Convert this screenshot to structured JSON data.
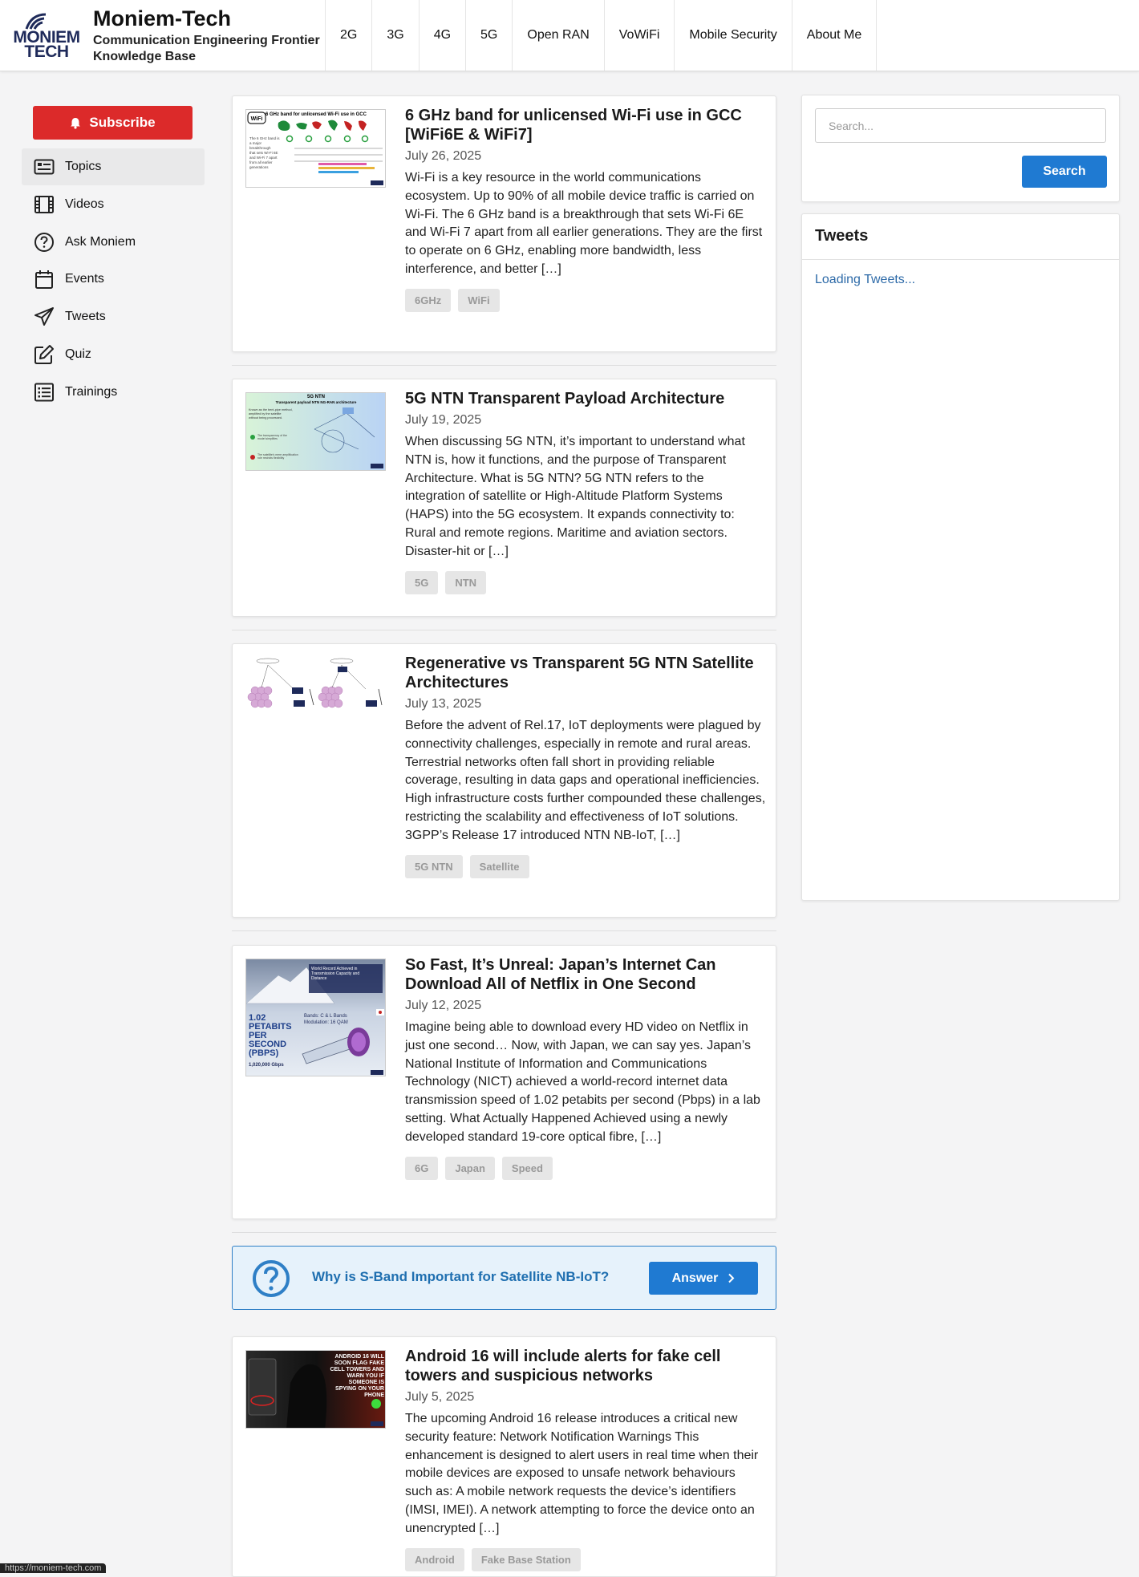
{
  "header": {
    "logo_line1": "MONIEM",
    "logo_line2": "TECH",
    "site_name": "Moniem-Tech",
    "tagline_line1": "Communication Engineering Frontier",
    "tagline_line2": "Knowledge Base",
    "nav": [
      "2G",
      "3G",
      "4G",
      "5G",
      "Open RAN",
      "VoWiFi",
      "Mobile Security",
      "About Me"
    ]
  },
  "sidebar": {
    "subscribe_label": "Subscribe",
    "items": [
      {
        "label": "Topics",
        "icon": "list-box-icon",
        "active": true
      },
      {
        "label": "Videos",
        "icon": "film-icon",
        "active": false
      },
      {
        "label": "Ask Moniem",
        "icon": "question-circle-icon",
        "active": false
      },
      {
        "label": "Events",
        "icon": "calendar-icon",
        "active": false
      },
      {
        "label": "Tweets",
        "icon": "paper-plane-icon",
        "active": false
      },
      {
        "label": "Quiz",
        "icon": "edit-icon",
        "active": false
      },
      {
        "label": "Trainings",
        "icon": "list-icon",
        "active": false
      }
    ]
  },
  "posts": [
    {
      "title": "6 GHz band for unlicensed Wi-Fi use in GCC [WiFi6E & WiFi7]",
      "date": "July 26, 2025",
      "excerpt": "Wi-Fi is a key resource in the world communications ecosystem. Up to 90% of all mobile device traffic is carried on Wi-Fi. The 6 GHz band is a breakthrough that sets Wi-Fi 6E and Wi-Fi 7 apart from all earlier generations. They are the first to operate on 6 GHz, enabling more bandwidth, less interference, and better […]",
      "tags": [
        "6GHz",
        "WiFi"
      ]
    },
    {
      "title": "5G NTN Transparent Payload Architecture",
      "date": "July 19, 2025",
      "excerpt": "When discussing 5G NTN, it’s important to understand what NTN is, how it functions, and the purpose of Transparent Architecture. What is 5G NTN? 5G NTN refers to the integration of satellite or High-Altitude Platform Systems (HAPS) into the 5G ecosystem. It expands connectivity to: Rural and remote regions. Maritime and aviation sectors. Disaster-hit or […]",
      "tags": [
        "5G",
        "NTN"
      ]
    },
    {
      "title": "Regenerative vs Transparent 5G NTN Satellite Architectures",
      "date": "July 13, 2025",
      "excerpt": "Before the advent of Rel.17, IoT deployments were plagued by connectivity challenges, especially in remote and rural areas. Terrestrial networks often fall short in providing reliable coverage, resulting in data gaps and operational inefficiencies. High infrastructure costs further compounded these challenges, restricting the scalability and effectiveness of IoT solutions. 3GPP’s Release 17 introduced NTN NB-IoT, […]",
      "tags": [
        "5G NTN",
        "Satellite"
      ]
    },
    {
      "title": "So Fast, It’s Unreal: Japan’s Internet Can Download All of Netflix in One Second",
      "date": "July 12, 2025",
      "excerpt": "Imagine being able to download every HD video on Netflix in just one second… Now, with Japan, we can say yes. Japan’s National Institute of Information and Communications Technology (NICT) achieved a world-record internet data transmission speed of 1.02 petabits per second (Pbps) in a lab setting. What Actually Happened Achieved using a newly developed standard 19-core optical fibre, […]",
      "tags": [
        "6G",
        "Japan",
        "Speed"
      ]
    },
    {
      "title": "Android 16 will include alerts for fake cell towers and suspicious networks",
      "date": "July 5, 2025",
      "excerpt": "The upcoming Android 16 release introduces a critical new security feature: Network Notification Warnings This enhancement is designed to alert users in real time when their mobile devices are exposed to unsafe network behaviours such as: A mobile network requests the device’s identifiers (IMSI, IMEI). A network attempting to force the device onto an unencrypted […]",
      "tags": [
        "Android",
        "Fake Base Station"
      ]
    }
  ],
  "thumbs": {
    "t1": {
      "title": "6 GHz band for unlicensed Wi-Fi use in GCC",
      "badge": "WiFi",
      "side": "The 6 GHz band is a major breakthrough that sets Wi-Fi 6E and Wi-Fi 7 apart from all earlier generations"
    },
    "t2": {
      "title": "5G NTN",
      "subtitle": "Transparent payload NTN NG-RAN architecture"
    },
    "t4": {
      "big": "1.02 PETABITS PER SECOND (PBPS)",
      "small": "1,020,000 Gbps",
      "bands": "Bands: C & L Bands",
      "mod": "Modulation: 16 QAM",
      "box": "World Record Achieved in Transmission Capacity and Distance"
    },
    "t5": {
      "line1": "ANDROID 16 WILL",
      "line2": "SOON FLAG FAKE",
      "line3": "CELL TOWERS AND",
      "line4": "WARN YOU IF",
      "line5": "SOMEONE IS",
      "line6": "SPYING ON YOUR",
      "line7": "PHONE"
    }
  },
  "question": {
    "text": "Why is S-Band Important for Satellite NB-IoT?",
    "button_label": "Answer"
  },
  "search": {
    "placeholder": "Search...",
    "button_label": "Search"
  },
  "tweets": {
    "title": "Tweets",
    "loading": "Loading Tweets..."
  },
  "statusbar": "https://moniem-tech.com",
  "colors": {
    "brand_red": "#dc2a2a",
    "accent_blue": "#1f7ad2",
    "q_bg": "#e6f2fb"
  }
}
